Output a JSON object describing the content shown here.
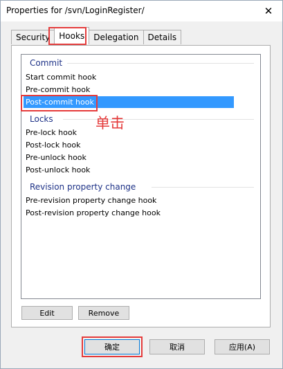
{
  "window": {
    "title": "Properties for /svn/LoginRegister/",
    "close_glyph": "✕"
  },
  "tabs": [
    {
      "label": "Security"
    },
    {
      "label": "Hooks"
    },
    {
      "label": "Delegation"
    },
    {
      "label": "Details"
    }
  ],
  "active_tab": "Hooks",
  "groups": {
    "commit": {
      "header": "Commit",
      "items": [
        "Start commit hook",
        "Pre-commit hook",
        "Post-commit hook"
      ]
    },
    "locks": {
      "header": "Locks",
      "items": [
        "Pre-lock hook",
        "Post-lock hook",
        "Pre-unlock hook",
        "Post-unlock hook"
      ]
    },
    "revprop": {
      "header": "Revision property change",
      "items": [
        "Pre-revision property change hook",
        "Post-revision property change hook"
      ]
    }
  },
  "selected_item": "Post-commit hook",
  "annotation": "单击",
  "buttons": {
    "edit": "Edit",
    "remove": "Remove",
    "ok": "确定",
    "cancel": "取消",
    "apply": "应用(A)"
  },
  "colors": {
    "selection": "#3399ff",
    "group_header": "#1e3287",
    "annotation_red": "#e53b3b"
  }
}
